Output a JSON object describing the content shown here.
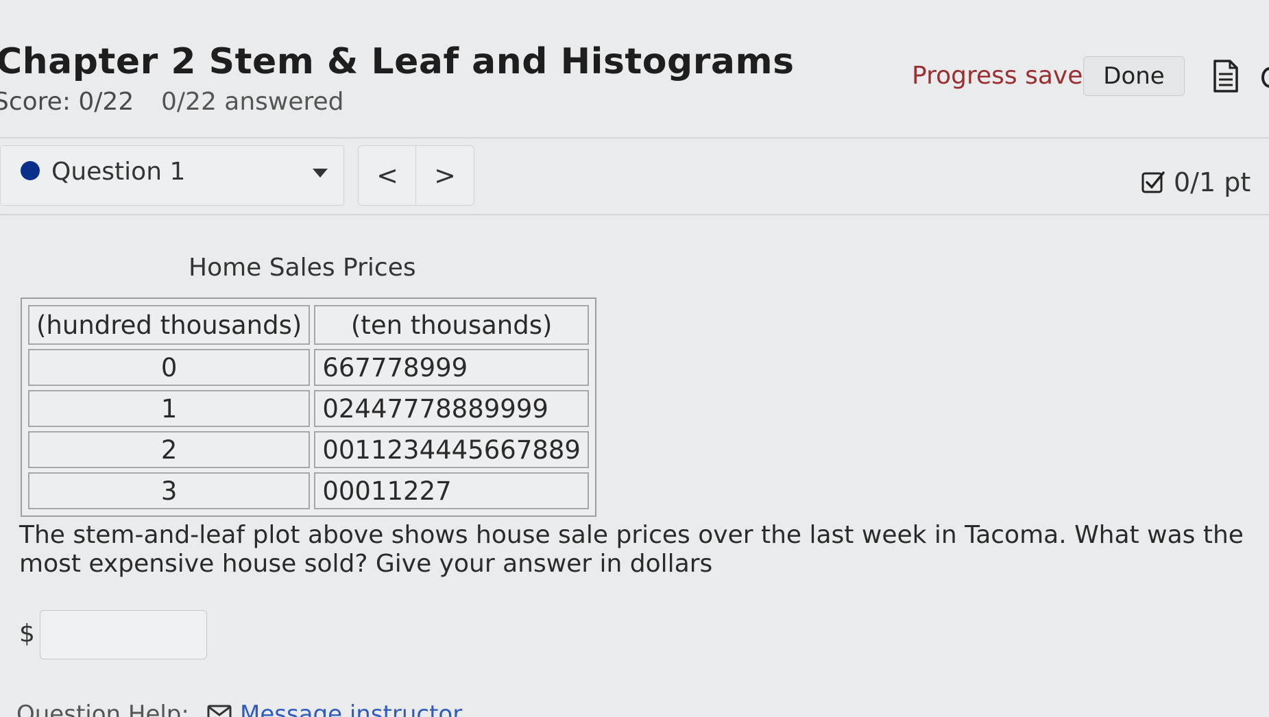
{
  "header": {
    "title": "Chapter 2 Stem & Leaf and Histograms",
    "score": "Score: 0/22",
    "answered": "0/22 answered",
    "progress_status": "Progress saved",
    "done_label": "Done",
    "status_color": "#9b2f2f"
  },
  "question_nav": {
    "selected_question": "Question 1",
    "prev_symbol": "<",
    "next_symbol": ">",
    "points": "0/1 pt",
    "dot_color": "#0a2f8a"
  },
  "stem_leaf_table": {
    "title": "Home Sales Prices",
    "headers": [
      "(hundred thousands)",
      "(ten thousands)"
    ],
    "rows": [
      {
        "stem": "0",
        "leaves": "667778999"
      },
      {
        "stem": "1",
        "leaves": "02447778889999"
      },
      {
        "stem": "2",
        "leaves": "0011234445667889"
      },
      {
        "stem": "3",
        "leaves": "00011227"
      }
    ]
  },
  "question": {
    "text": "The stem-and-leaf plot above shows house sale prices over the last week in Tacoma. What was the most expensive house sold? Give your answer in dollars",
    "currency_symbol": "$",
    "answer_value": "",
    "answer_placeholder": ""
  },
  "help": {
    "label": "Question Help:",
    "message_link": "Message instructor",
    "link_color": "#2f5bbf"
  },
  "icons": {
    "notes": "notes-icon",
    "check": "checkbox-check-icon",
    "mail": "mail-icon",
    "caret": "caret-down-icon"
  }
}
